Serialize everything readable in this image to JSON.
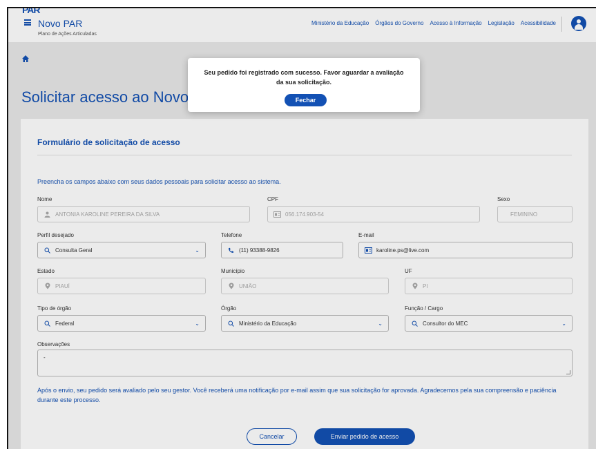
{
  "header": {
    "logo": "PAR",
    "title": "Novo PAR",
    "subtitle": "Plano de Ações Articuladas",
    "links": [
      "Ministério da Educação",
      "Órgãos do Governo",
      "Acesso à Informação",
      "Legislação",
      "Acessibilidade"
    ]
  },
  "page": {
    "title": "Solicitar acesso ao Novo PAR"
  },
  "form": {
    "title": "Formulário de solicitação de acesso",
    "intro": "Preencha os campos abaixo com seus dados pessoais para solicitar acesso ao sistema.",
    "nome": {
      "label": "Nome",
      "value": "ANTONIA KAROLINE PEREIRA DA SILVA"
    },
    "cpf": {
      "label": "CPF",
      "value": "056.174.903-54"
    },
    "sexo": {
      "label": "Sexo",
      "value": "FEMININO"
    },
    "perfil": {
      "label": "Perfil desejado",
      "value": "Consulta Geral"
    },
    "telefone": {
      "label": "Telefone",
      "value": "(11) 93388-9826"
    },
    "email": {
      "label": "E-mail",
      "value": "karoline.ps@live.com"
    },
    "estado": {
      "label": "Estado",
      "value": "PIAUÍ"
    },
    "municipio": {
      "label": "Município",
      "value": "UNIÃO"
    },
    "uf": {
      "label": "UF",
      "value": "PI"
    },
    "tipo_orgao": {
      "label": "Tipo de órgão",
      "value": "Federal"
    },
    "orgao": {
      "label": "Órgão",
      "value": "Ministério da Educação"
    },
    "funcao": {
      "label": "Função / Cargo",
      "value": "Consultor do MEC"
    },
    "observacoes": {
      "label": "Observações",
      "value": "-"
    },
    "footnote": "Após o envio, seu pedido será avaliado pelo seu gestor. Você receberá uma notificação por e-mail assim que sua solicitação for aprovada. Agradecemos pela sua compreensão e paciência durante este processo.",
    "cancel_label": "Cancelar",
    "submit_label": "Enviar pedido de acesso"
  },
  "modal": {
    "message": "Seu pedido foi registrado com sucesso. Favor aguardar a avaliação da sua solicitação.",
    "close_label": "Fechar"
  },
  "icons": {
    "menu": "menu-icon",
    "home": "home-icon",
    "user": "user-icon",
    "id": "id-card-icon",
    "search": "search-icon",
    "phone": "phone-icon",
    "location": "location-pin-icon",
    "chevron": "chevron-down-icon"
  },
  "colors": {
    "primary": "#1351b4",
    "overlay": "#e9e9e9"
  }
}
